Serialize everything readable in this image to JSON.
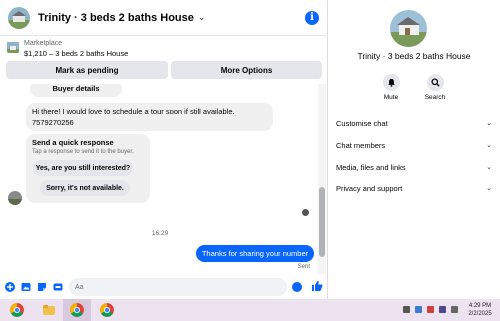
{
  "header": {
    "title": "Trinity · 3 beds 2 baths House",
    "info_icon": "i"
  },
  "marketplace": {
    "label": "Marketplace",
    "listing": "$1,210 – 3 beds 2 baths House",
    "pending_button": "Mark as pending",
    "more_button": "More Options"
  },
  "messages": {
    "buyer_details": "Buyer details",
    "incoming_text": "Hi there! I would love to schedule a tour soon if still available. 757‏9270256",
    "quick_title": "Send a quick response",
    "quick_sub": "Tap a response to send it to the buyer.",
    "quick_options": [
      "Yes, are you still interested?",
      "Sorry, it's not available."
    ],
    "timestamp": "16:29",
    "sent_text": "Thanks for sharing your number",
    "sent_status": "Sent"
  },
  "composer": {
    "placeholder": "Aa"
  },
  "right_panel": {
    "title": "Trinity · 3 beds 2 baths House",
    "actions": [
      {
        "label": "Mute",
        "icon": "bell-icon"
      },
      {
        "label": "Search",
        "icon": "search-icon"
      }
    ],
    "sections": [
      "Customise chat",
      "Chat members",
      "Media, files and links",
      "Privacy and support"
    ]
  },
  "taskbar": {
    "time": "4:29 PM",
    "date": "2/2/2025"
  },
  "colors": {
    "accent": "#0866ff",
    "bubble_gray": "#f0f0f0",
    "button_gray": "#e4e6eb"
  }
}
